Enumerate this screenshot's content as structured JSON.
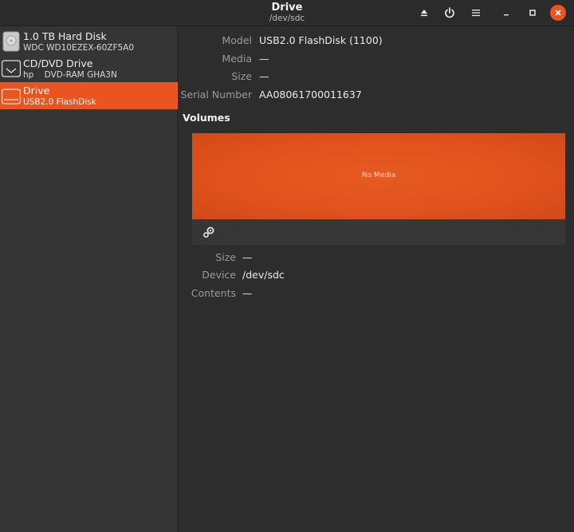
{
  "window": {
    "title": "Drive",
    "subtitle": "/dev/sdc",
    "buttons": {
      "eject": "eject-icon",
      "power": "power-icon",
      "menu": "hamburger-menu-icon",
      "minimize": "minimize-icon",
      "maximize": "maximize-icon",
      "close": "close-icon"
    },
    "accent": "#e95420"
  },
  "sidebar": {
    "items": [
      {
        "name": "1.0 TB Hard Disk",
        "sub": "WDC WD10EZEX-60ZF5A0",
        "icon": "hard-disk-icon",
        "selected": false
      },
      {
        "name": "CD/DVD Drive",
        "sub": "hp    DVD-RAM GHA3N",
        "icon": "optical-drive-icon",
        "selected": false
      },
      {
        "name": "Drive",
        "sub": "USB2.0 FlashDisk",
        "icon": "usb-drive-icon",
        "selected": true
      }
    ]
  },
  "drive": {
    "model_label": "Model",
    "model": "USB2.0 FlashDisk (1100)",
    "media_label": "Media",
    "media": "—",
    "size_label": "Size",
    "size": "—",
    "serial_label": "Serial Number",
    "serial": "AA08061700011637"
  },
  "volumes": {
    "title": "Volumes",
    "segment_label": "No Media",
    "tool_icon": "gears-icon"
  },
  "volume_info": {
    "size_label": "Size",
    "size": "—",
    "device_label": "Device",
    "device": "/dev/sdc",
    "contents_label": "Contents",
    "contents": "—"
  }
}
